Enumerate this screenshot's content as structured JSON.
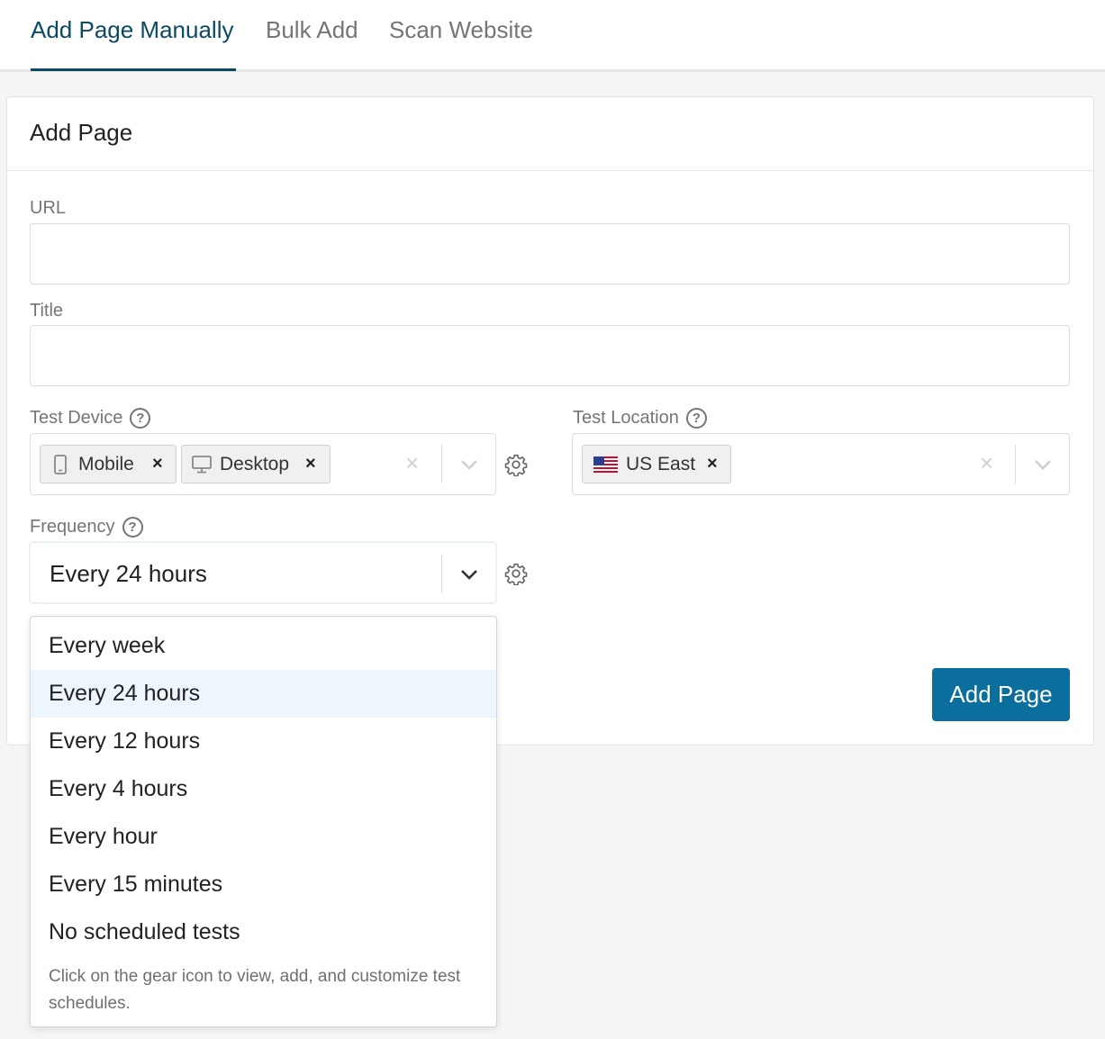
{
  "tabs": [
    {
      "label": "Add Page Manually",
      "active": true
    },
    {
      "label": "Bulk Add",
      "active": false
    },
    {
      "label": "Scan Website",
      "active": false
    }
  ],
  "card": {
    "title": "Add Page"
  },
  "form": {
    "url_label": "URL",
    "url_value": "",
    "title_label": "Title",
    "title_value": "",
    "device_label": "Test Device",
    "devices": [
      {
        "label": "Mobile",
        "icon": "mobile-icon"
      },
      {
        "label": "Desktop",
        "icon": "desktop-icon"
      }
    ],
    "location_label": "Test Location",
    "locations": [
      {
        "label": "US East",
        "icon": "us-flag-icon"
      }
    ],
    "frequency_label": "Frequency",
    "frequency_value": "Every 24 hours",
    "remove_symbol": "×",
    "help_symbol": "?"
  },
  "frequency_menu": {
    "options": [
      "Every week",
      "Every 24 hours",
      "Every 12 hours",
      "Every 4 hours",
      "Every hour",
      "Every 15 minutes",
      "No scheduled tests"
    ],
    "selected_index": 1,
    "hint": "Click on the gear icon to view, add, and customize test schedules."
  },
  "actions": {
    "add_page_label": "Add Page"
  },
  "colors": {
    "accent": "#0b4a63",
    "button": "#0c6e9c",
    "selected_bg": "#edf5fd"
  }
}
